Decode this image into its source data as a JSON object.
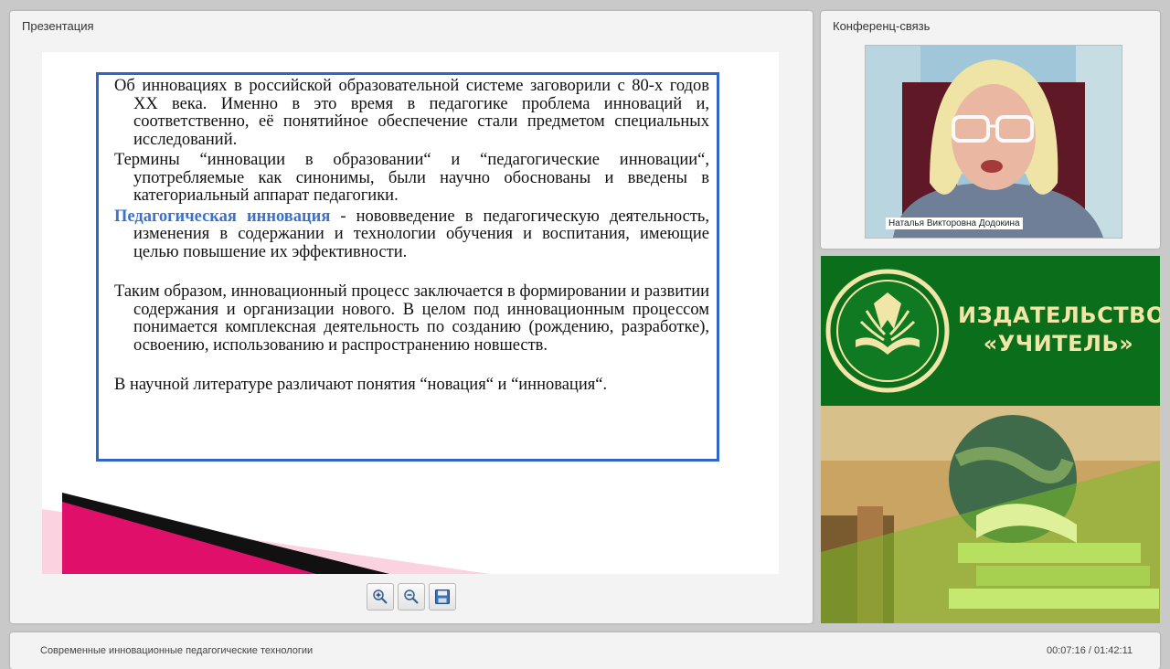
{
  "presentation": {
    "title": "Презентация",
    "slide": {
      "paragraphs": [
        "Об инновациях в российской образовательной системе заговорили с 80-х годов XX века. Именно в это время в педагогике проблема инноваций и, соответственно, её понятийное обеспечение стали предметом специальных исследований.",
        "Термины “инновации в образовании“ и “педагогические инновации“, употребляемые как синонимы, были научно обоснованы и введены в категориальный аппарат педагогики."
      ],
      "definition_term": "Педагогическая инновация",
      "definition_text": " - нововведение в педагогическую деятельность, изменения в содержании и технологии обучения и воспитания, имеющие целью повышение их эффективности.",
      "paragraph_process": "Таким образом, инновационный процесс заключается в формировании и развитии содержания и организации нового. В целом под инновационным процессом понимается комплексная деятельность по созданию (рождению, разработке), освоению, использованию и распространению новшеств.",
      "paragraph_last": "В научной литературе различают понятия “новация“ и “инновация“."
    },
    "toolbar": [
      {
        "icon": "zoom-in-icon"
      },
      {
        "icon": "zoom-out-icon"
      },
      {
        "icon": "save-icon"
      }
    ],
    "colors": {
      "accent": "#2f67c9",
      "term": "#3a72d0",
      "deco_pink": "#e0106a"
    }
  },
  "conference": {
    "title": "Конференц-связь",
    "speaker_name": "Наталья Викторовна Додокина"
  },
  "publisher": {
    "name": "ИЗДАТЕЛЬСТВО\n«УЧИТЕЛЬ»",
    "colors": {
      "background": "#0b6e1b",
      "text": "#f1e6a8"
    }
  },
  "footer": {
    "course_title": "Современные инновационные педагогические технологии",
    "timecode": "00:07:16 / 01:42:11"
  }
}
